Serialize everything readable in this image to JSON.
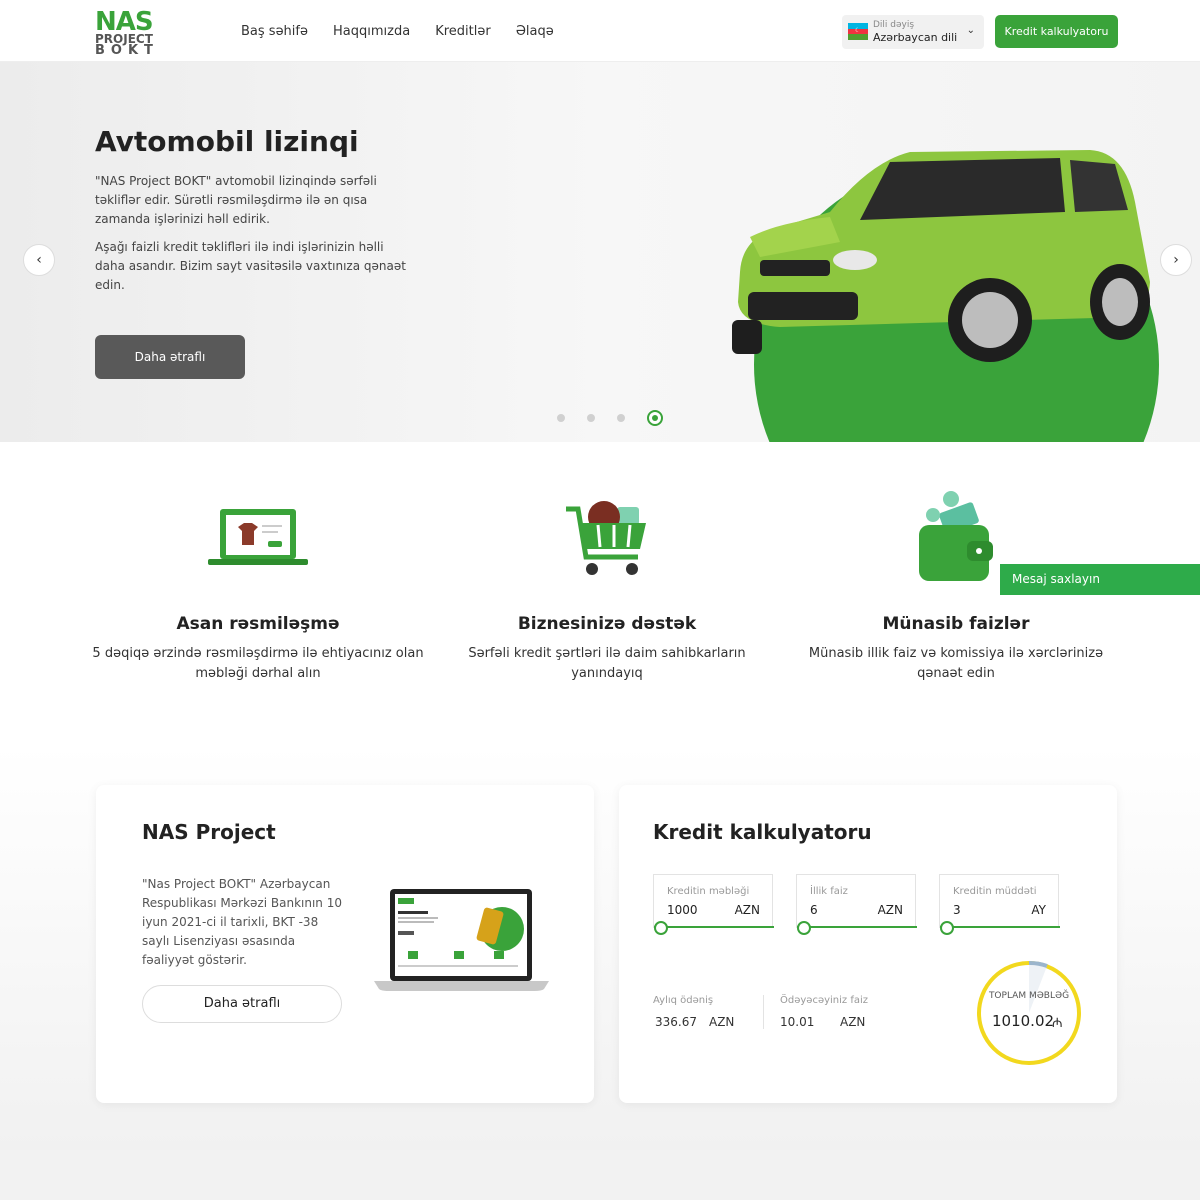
{
  "header": {
    "logo": {
      "line1": "NAS",
      "line2": "PROJECT",
      "line3": "BOKT"
    },
    "nav": [
      "Baş səhifə",
      "Haqqımızda",
      "Kreditlər",
      "Əlaqə"
    ],
    "lang": {
      "label": "Dili dəyiş",
      "value": "Azərbaycan dili"
    },
    "calc_button": "Kredit kalkulyatoru"
  },
  "hero": {
    "title": "Avtomobil lizinqi",
    "paragraph1": "\"NAS Project BOKT\" avtomobil lizinqində sərfəli təkliflər edir. Sürətli rəsmiləşdirmə ilə ən qısa zamanda işlərinizi həll edirik.",
    "paragraph2": "Aşağı faizli kredit təklifləri ilə indi işlərinizin həlli daha asandır. Bizim sayt vasitəsilə vaxtınıza qənaət edin.",
    "button": "Daha ətraflı",
    "slides": 4,
    "active_slide": 4
  },
  "features": [
    {
      "icon": "laptop-shop-icon",
      "title": "Asan rəsmiləşmə",
      "text": "5 dəqiqə ərzində rəsmiləşdirmə ilə ehtiyacınız olan məbləği dərhal alın"
    },
    {
      "icon": "shopping-cart-icon",
      "title": "Biznesinizə dəstək",
      "text": "Sərfəli kredit şərtləri ilə daim sahibkarların yanındayıq"
    },
    {
      "icon": "wallet-money-icon",
      "title": "Münasib faizlər",
      "text": "Münasib illik faiz və komissiya ilə xərclərinizə qənaət edin"
    }
  ],
  "message_tab": "Mesaj saxlayın",
  "about": {
    "title": "NAS Project",
    "text": "\"Nas Project BOKT\" Azərbaycan Respublikası Mərkəzi Bankının 10 iyun 2021-ci il tarixli, BKT -38 saylı Lisenziyası əsasında fəaliyyət göstərir.",
    "button": "Daha ətraflı"
  },
  "calculator": {
    "title": "Kredit kalkulyatoru",
    "fields": [
      {
        "label": "Kreditin məbləği",
        "value": "1000",
        "unit": "AZN"
      },
      {
        "label": "İllik faiz",
        "value": "6",
        "unit": "AZN"
      },
      {
        "label": "Kreditin müddəti",
        "value": "3",
        "unit": "AY"
      }
    ],
    "monthly": {
      "label": "Aylıq ödəniş",
      "value": "336.67",
      "unit": "AZN"
    },
    "interest": {
      "label": "Ödəyəcəyiniz faiz",
      "value": "10.01",
      "unit": "AZN"
    },
    "total": {
      "label": "TOPLAM MƏBLƏĞ",
      "value": "1010.02",
      "currency": "₼"
    }
  },
  "colors": {
    "brand_green": "#3aa33a",
    "dark_button": "#595959",
    "total_ring": "#f2d81e"
  }
}
